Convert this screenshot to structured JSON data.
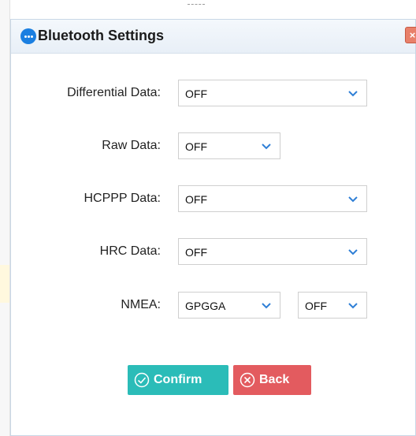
{
  "dialog": {
    "title": "Bluetooth Settings",
    "close_glyph": "×"
  },
  "form": {
    "differential_data": {
      "label": "Differential Data:",
      "value": "OFF"
    },
    "raw_data": {
      "label": "Raw Data:",
      "value": "OFF"
    },
    "hcppp_data": {
      "label": "HCPPP Data:",
      "value": "OFF"
    },
    "hrc_data": {
      "label": "HRC Data:",
      "value": "OFF"
    },
    "nmea": {
      "label": "NMEA:",
      "sentence_value": "GPGGA",
      "rate_value": "OFF"
    }
  },
  "buttons": {
    "confirm": "Confirm",
    "back": "Back"
  },
  "icons": {
    "title": "chat-bubble-icon",
    "close": "close-icon",
    "dropdown": "chevron-down-icon",
    "confirm": "check-circle-icon",
    "back": "x-circle-icon"
  },
  "colors": {
    "title_icon": "#1b7fe1",
    "chevron": "#2f7fd6",
    "confirm_button": "#2bbcb8",
    "back_button": "#e35b5f",
    "close_button": "#e8806a"
  }
}
